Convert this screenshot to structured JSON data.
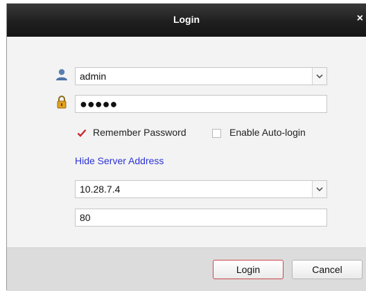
{
  "window": {
    "title": "Login",
    "close_label": "×"
  },
  "form": {
    "username": {
      "value": "admin",
      "icon": "user-icon"
    },
    "password": {
      "masked_value": "●●●●●",
      "icon": "lock-icon"
    },
    "remember_password": {
      "label": "Remember Password",
      "checked": true
    },
    "auto_login": {
      "label": "Enable Auto-login",
      "checked": false
    },
    "server_toggle_link": "Hide Server Address",
    "server_address": {
      "value": "10.28.7.4"
    },
    "port": {
      "value": "80"
    }
  },
  "buttons": {
    "login_label": "Login",
    "cancel_label": "Cancel"
  },
  "colors": {
    "titlebar": "#1f1f1f",
    "link": "#2c33d6",
    "checkmark": "#c8282f",
    "primary_border": "#c9464c"
  }
}
